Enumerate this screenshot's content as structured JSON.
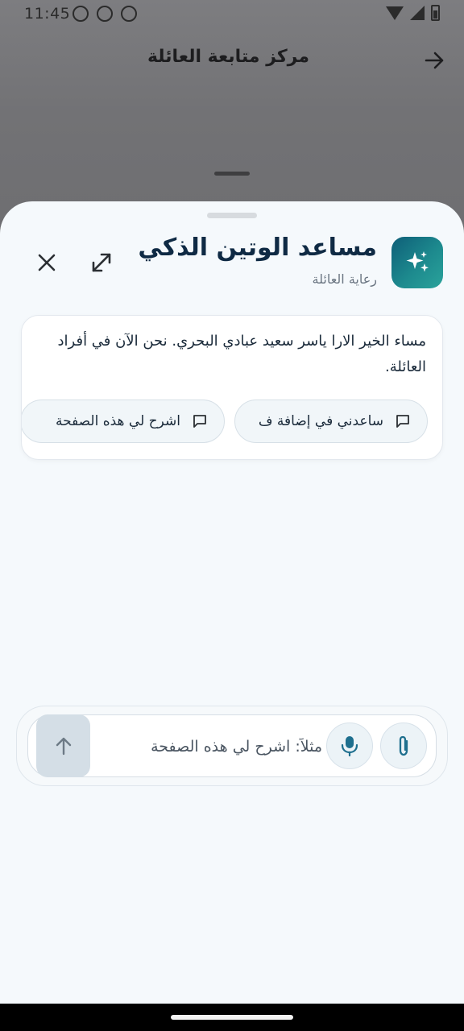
{
  "status_bar": {
    "time": "11:45"
  },
  "background_page": {
    "title": "مركز متابعة العائلة"
  },
  "assistant": {
    "title": "مساعد الوتين الذكي",
    "subtitle": "رعاية العائلة",
    "greeting": "مساء الخير الارا ياسر سعيد عبادي البحري. نحن الآن في أفراد العائلة.",
    "suggestions": [
      {
        "label": "اشرح لي هذه الصفحة",
        "icon": "chat-bubble-icon"
      },
      {
        "label": "ساعدني في إضافة ف",
        "icon": "chat-bubble-icon"
      }
    ]
  },
  "composer": {
    "placeholder": "مثلاً: اشرح لي هذه الصفحة"
  },
  "colors": {
    "brand_gradient_start": "#0e5e78",
    "brand_gradient_end": "#2aa39b",
    "title_text": "#0f2a44",
    "sheet_background": "#f5f9fc",
    "send_button_disabled": "#d4dee6"
  }
}
